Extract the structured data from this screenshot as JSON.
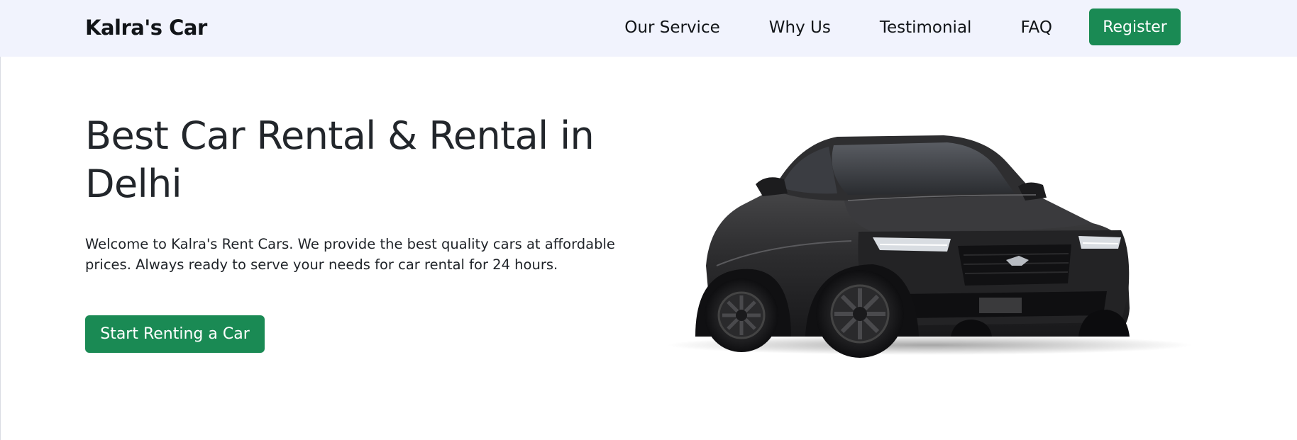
{
  "navbar": {
    "brand": "Kalra's Car",
    "links": [
      {
        "label": "Our Service"
      },
      {
        "label": "Why Us"
      },
      {
        "label": "Testimonial"
      },
      {
        "label": "FAQ"
      }
    ],
    "register_label": "Register"
  },
  "hero": {
    "title_line1": "Best Car Rental & Rental in",
    "title_line2": "Delhi",
    "description_line1": "Welcome to Kalra's Rent Cars. We provide the best quality cars at affordable",
    "description_line2": "prices. Always ready to serve your needs for car rental for 24 hours.",
    "cta_label": "Start Renting a Car"
  },
  "images": {
    "hero_car": "car-image"
  },
  "colors": {
    "nav_background": "#f1f3fd",
    "accent_green": "#1a8a54",
    "text_dark": "#22262b"
  }
}
